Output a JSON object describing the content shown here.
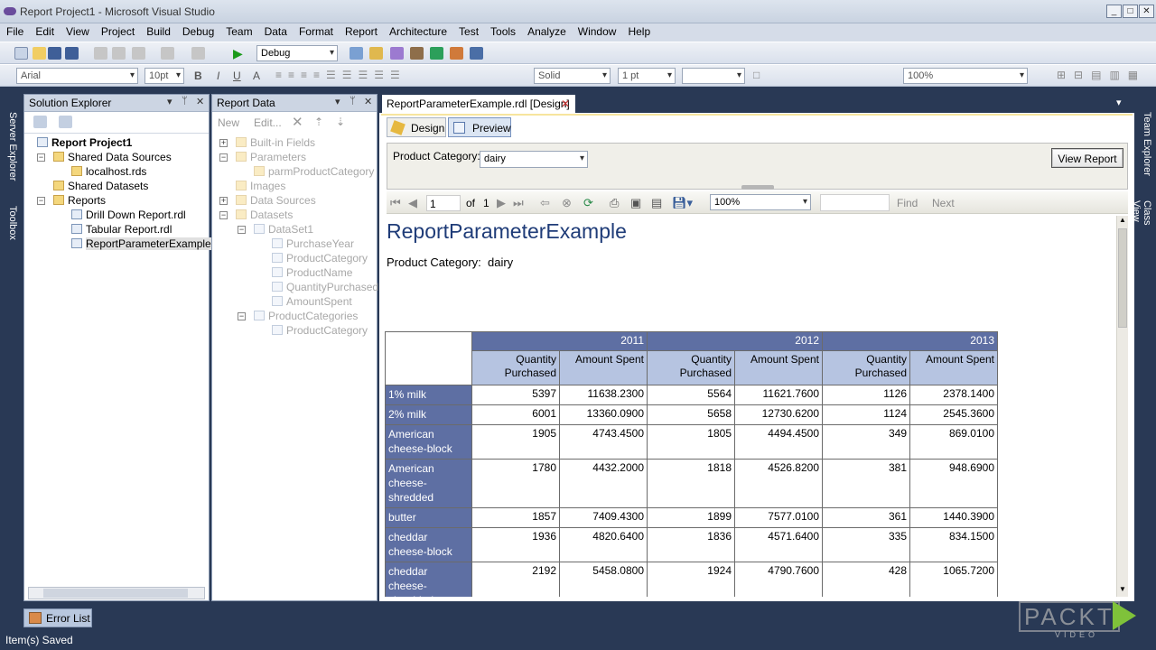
{
  "window": {
    "title": "Report Project1 - Microsoft Visual Studio"
  },
  "menu": [
    "File",
    "Edit",
    "View",
    "Project",
    "Build",
    "Debug",
    "Team",
    "Data",
    "Format",
    "Report",
    "Architecture",
    "Test",
    "Tools",
    "Analyze",
    "Window",
    "Help"
  ],
  "toolbar": {
    "config": "Debug",
    "font": "Arial",
    "font_size": "10pt",
    "border_style": "Solid",
    "border_width": "1 pt",
    "zoom": "100%"
  },
  "side_tabs": {
    "left": [
      "Server Explorer",
      "Toolbox"
    ],
    "right": [
      "Team Explorer",
      "Class View"
    ]
  },
  "solution_explorer": {
    "title": "Solution Explorer",
    "items": [
      "Report Project1",
      "Shared Data Sources",
      "localhost.rds",
      "Shared Datasets",
      "Reports",
      "Drill Down Report.rdl",
      "Tabular Report.rdl",
      "ReportParameterExample.r"
    ]
  },
  "report_data": {
    "title": "Report Data",
    "new": "New",
    "edit": "Edit...",
    "items": [
      "Built-in Fields",
      "Parameters",
      "parmProductCategory",
      "Images",
      "Data Sources",
      "Datasets",
      "DataSet1",
      "PurchaseYear",
      "ProductCategory",
      "ProductName",
      "QuantityPurchased",
      "AmountSpent",
      "ProductCategories",
      "ProductCategory"
    ]
  },
  "doc": {
    "tab": "ReportParameterExample.rdl [Design]",
    "design_tab": "Design",
    "preview_tab": "Preview"
  },
  "param": {
    "label": "Product Category:",
    "value": "dairy",
    "view_button": "View Report"
  },
  "report_toolbar": {
    "page": "1",
    "of": "of",
    "total": "1",
    "zoom": "100%",
    "find": "Find",
    "next": "Next"
  },
  "report": {
    "title": "ReportParameterExample",
    "param_line": "Product Category:  dairy",
    "years": [
      "2011",
      "2012",
      "2013"
    ],
    "col_qty": "Quantity Purchased",
    "col_amt": "Amount Spent",
    "rows": [
      {
        "name": "1% milk",
        "v": [
          "5397",
          "11638.2300",
          "5564",
          "11621.7600",
          "1126",
          "2378.1400"
        ]
      },
      {
        "name": "2% milk",
        "v": [
          "6001",
          "13360.0900",
          "5658",
          "12730.6200",
          "1124",
          "2545.3600"
        ]
      },
      {
        "name": "American cheese-block",
        "v": [
          "1905",
          "4743.4500",
          "1805",
          "4494.4500",
          "349",
          "869.0100"
        ]
      },
      {
        "name": "American cheese-shredded",
        "v": [
          "1780",
          "4432.2000",
          "1818",
          "4526.8200",
          "381",
          "948.6900"
        ]
      },
      {
        "name": "butter",
        "v": [
          "1857",
          "7409.4300",
          "1899",
          "7577.0100",
          "361",
          "1440.3900"
        ]
      },
      {
        "name": "cheddar cheese-block",
        "v": [
          "1936",
          "4820.6400",
          "1836",
          "4571.6400",
          "335",
          "834.1500"
        ]
      },
      {
        "name": "cheddar cheese-shredded",
        "v": [
          "2192",
          "5458.0800",
          "1924",
          "4790.7600",
          "428",
          "1065.7200"
        ]
      }
    ]
  },
  "error_list": "Error List",
  "status": "Item(s) Saved",
  "logo": {
    "brand": "PACKT",
    "sub": "VIDEO"
  }
}
